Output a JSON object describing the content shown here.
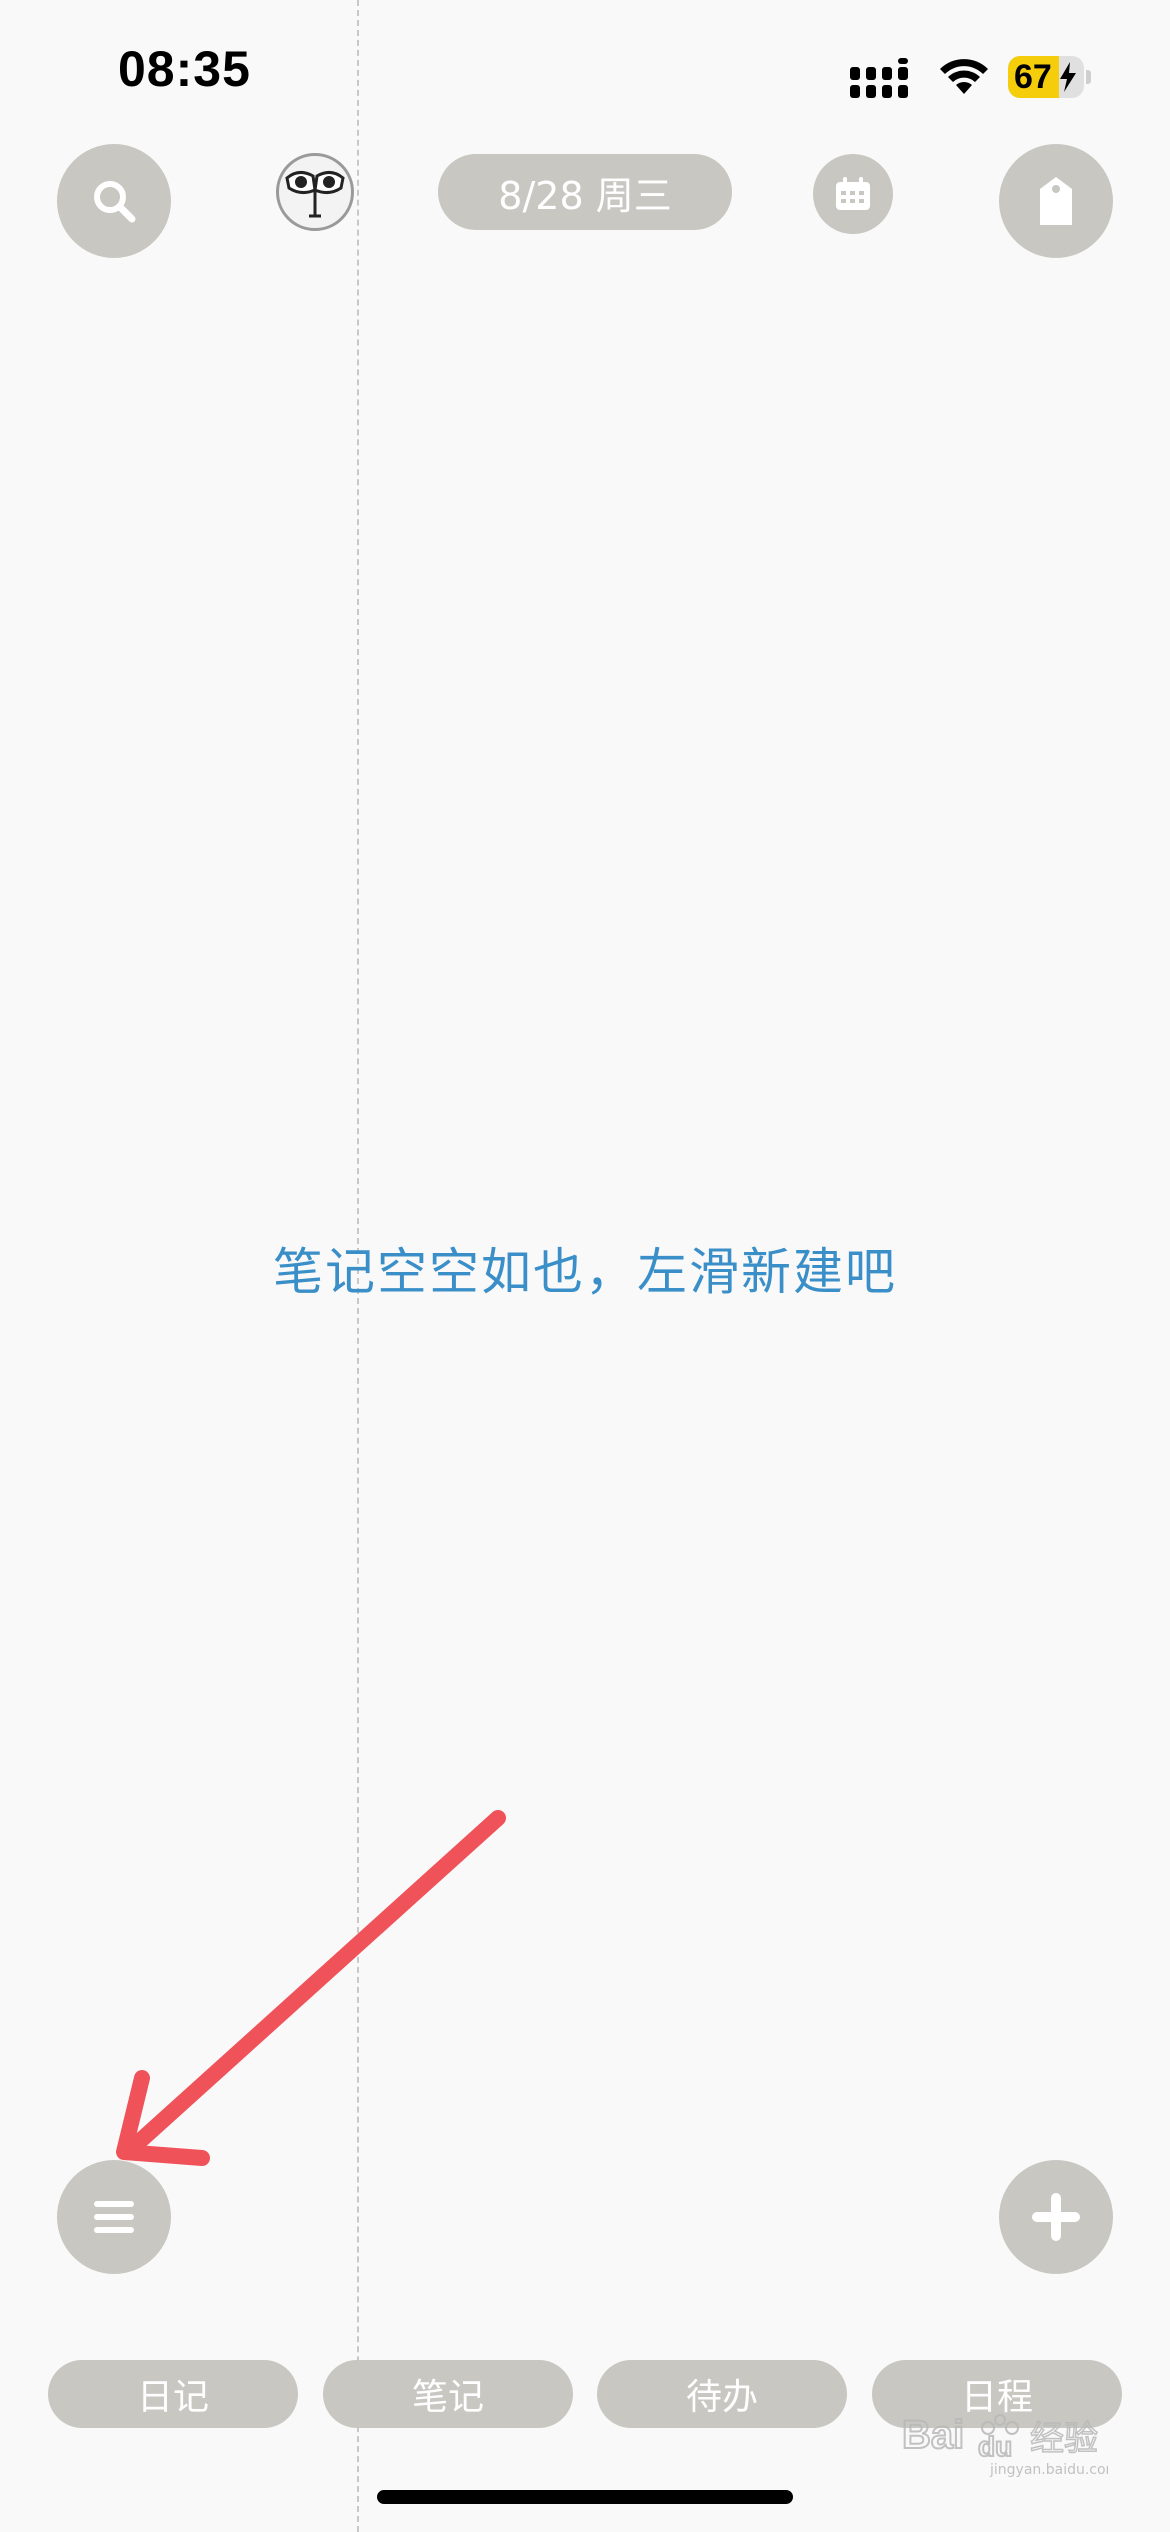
{
  "status_bar": {
    "time": "08:35",
    "battery_level": "67"
  },
  "header": {
    "date_label": "8/28 周三",
    "icons": {
      "search": "search-icon",
      "avatar": "avatar",
      "calendar": "calendar-icon",
      "tag": "tag-icon"
    }
  },
  "main": {
    "empty_message": "笔记空空如也，左滑新建吧"
  },
  "floating": {
    "menu_icon": "menu-icon",
    "add_icon": "plus-icon"
  },
  "tabs": [
    {
      "label": "日记"
    },
    {
      "label": "笔记"
    },
    {
      "label": "待办"
    },
    {
      "label": "日程"
    }
  ],
  "watermark": {
    "text": "Baidu 经验",
    "subtext": "jingyan.baidu.com"
  },
  "colors": {
    "button_gray": "#c8c7c2",
    "message_blue": "#3a8fc8",
    "annotation_red": "#f0525a",
    "battery_yellow": "#f5cd0b"
  }
}
